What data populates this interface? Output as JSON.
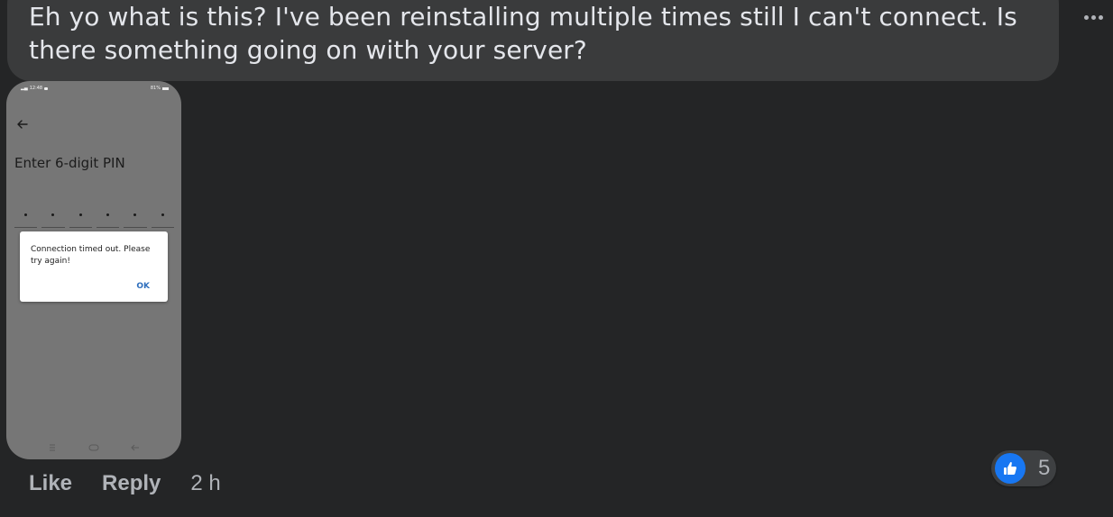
{
  "comment": {
    "text_lines": [
      "Eh yo what is this? I've been reinstalling multiple times still I can't connect. Is",
      "there something going on with your server?"
    ]
  },
  "menu_icon": "more-horizontal-icon",
  "attachment": {
    "status_bar": {
      "time": "12:48",
      "battery": "81%"
    },
    "screen_title": "Enter 6-digit PIN",
    "pin_length": 6,
    "dialog": {
      "message": "Connection timed out. Please try again!",
      "ok_label": "OK"
    },
    "nav_icons": [
      "menu-icon",
      "home-icon",
      "back-icon"
    ]
  },
  "actions": {
    "like_label": "Like",
    "reply_label": "Reply",
    "timestamp": "2 h"
  },
  "reactions": {
    "icon": "thumbs-up-icon",
    "count": "5",
    "color": "#1877f2"
  },
  "colors": {
    "background": "#242526",
    "bubble": "#3a3b3c",
    "text_primary": "#e4e6eb",
    "text_secondary": "#b0b3b8"
  }
}
